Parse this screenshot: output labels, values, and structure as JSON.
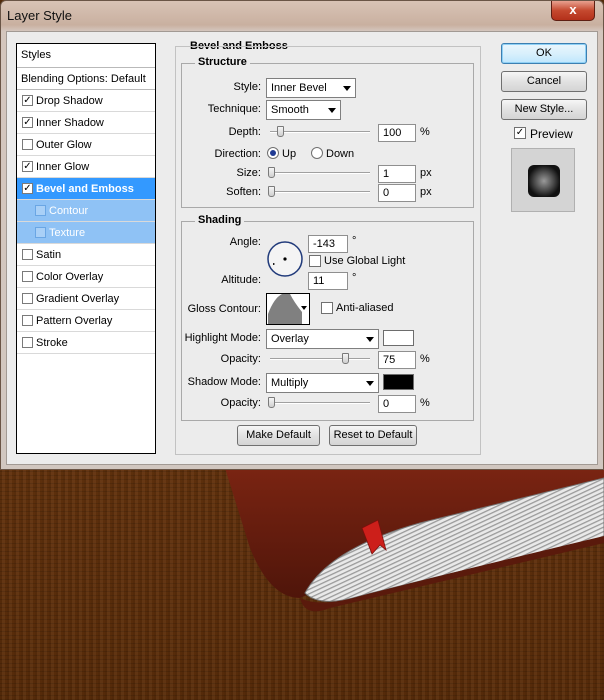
{
  "window": {
    "title": "Layer Style",
    "close_glyph": "x"
  },
  "styles_panel": {
    "header": "Styles",
    "blending_options": "Blending Options: Default",
    "items": [
      {
        "label": "Drop Shadow",
        "checked": true,
        "state": "normal"
      },
      {
        "label": "Inner Shadow",
        "checked": true,
        "state": "normal"
      },
      {
        "label": "Outer Glow",
        "checked": false,
        "state": "normal"
      },
      {
        "label": "Inner Glow",
        "checked": true,
        "state": "normal"
      },
      {
        "label": "Bevel and Emboss",
        "checked": true,
        "state": "selected"
      },
      {
        "label": "Contour",
        "checked": false,
        "state": "sub"
      },
      {
        "label": "Texture",
        "checked": false,
        "state": "sub"
      },
      {
        "label": "Satin",
        "checked": false,
        "state": "normal"
      },
      {
        "label": "Color Overlay",
        "checked": false,
        "state": "normal"
      },
      {
        "label": "Gradient Overlay",
        "checked": false,
        "state": "normal"
      },
      {
        "label": "Pattern Overlay",
        "checked": false,
        "state": "normal"
      },
      {
        "label": "Stroke",
        "checked": false,
        "state": "normal"
      }
    ]
  },
  "bevel": {
    "section_title": "Bevel and Emboss",
    "structure": {
      "title": "Structure",
      "style_label": "Style:",
      "style_value": "Inner Bevel",
      "technique_label": "Technique:",
      "technique_value": "Smooth",
      "depth_label": "Depth:",
      "depth_value": "100",
      "depth_unit": "%",
      "direction_label": "Direction:",
      "direction_up": "Up",
      "direction_down": "Down",
      "direction_selected": "Up",
      "size_label": "Size:",
      "size_value": "1",
      "size_unit": "px",
      "soften_label": "Soften:",
      "soften_value": "0",
      "soften_unit": "px"
    },
    "shading": {
      "title": "Shading",
      "angle_label": "Angle:",
      "angle_value": "-143",
      "degree": "°",
      "use_global_light": "Use Global Light",
      "use_global_light_checked": false,
      "altitude_label": "Altitude:",
      "altitude_value": "11",
      "gloss_contour_label": "Gloss Contour:",
      "anti_aliased": "Anti-aliased",
      "anti_aliased_checked": false,
      "highlight_mode_label": "Highlight Mode:",
      "highlight_mode_value": "Overlay",
      "highlight_color": "#ffffff",
      "highlight_opacity_label": "Opacity:",
      "highlight_opacity_value": "75",
      "shadow_mode_label": "Shadow Mode:",
      "shadow_mode_value": "Multiply",
      "shadow_color": "#000000",
      "shadow_opacity_label": "Opacity:",
      "shadow_opacity_value": "0",
      "percent": "%"
    },
    "make_default": "Make Default",
    "reset_to_default": "Reset to Default"
  },
  "actions": {
    "ok": "OK",
    "cancel": "Cancel",
    "new_style": "New Style...",
    "preview": "Preview",
    "preview_checked": true
  },
  "colors": {
    "selection": "#3399ff",
    "sub_selection": "#8fc2f5",
    "background_wood": "#5f300c",
    "book_cover": "#6b1f10",
    "bookmark": "#cc1f1a"
  }
}
